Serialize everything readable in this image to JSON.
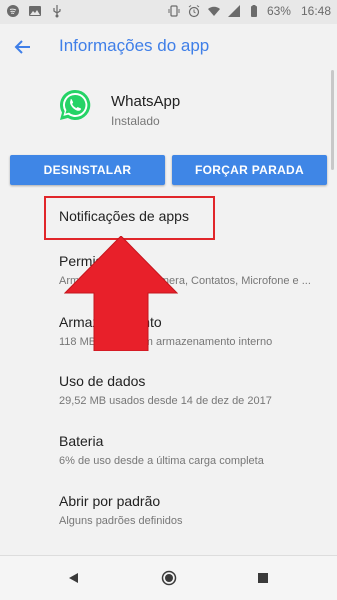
{
  "status_bar": {
    "battery": "63%",
    "time": "16:48",
    "icons_left": [
      "spotify-icon",
      "gallery-icon",
      "usb-icon"
    ],
    "icons_right": [
      "vibrate-icon",
      "alarm-icon",
      "wifi-icon",
      "signal-icon",
      "battery-icon"
    ]
  },
  "appbar": {
    "title": "Informações do app",
    "back_icon": "arrow-back-icon"
  },
  "app": {
    "name": "WhatsApp",
    "status": "Instalado",
    "icon": "whatsapp-icon"
  },
  "actions": {
    "uninstall": "DESINSTALAR",
    "force_stop": "FORÇAR PARADA"
  },
  "settings": [
    {
      "title": "Notificações de apps",
      "subtitle": ""
    },
    {
      "title": "Permissões",
      "subtitle": "Armazenamento, Câmera, Contatos, Microfone e ..."
    },
    {
      "title": "Armazenamento",
      "subtitle": "118 MB usados em armazenamento interno"
    },
    {
      "title": "Uso de dados",
      "subtitle": "29,52 MB usados desde 14 de dez de 2017"
    },
    {
      "title": "Bateria",
      "subtitle": "6% de uso desde a última carga completa"
    },
    {
      "title": "Abrir por padrão",
      "subtitle": "Alguns padrões definidos"
    }
  ],
  "colors": {
    "accent": "#3f86e6",
    "title": "#3f7fe8",
    "highlight": "#e1262a",
    "whatsapp": "#25d366"
  },
  "navigation": [
    "back-icon",
    "home-icon",
    "recents-icon"
  ]
}
